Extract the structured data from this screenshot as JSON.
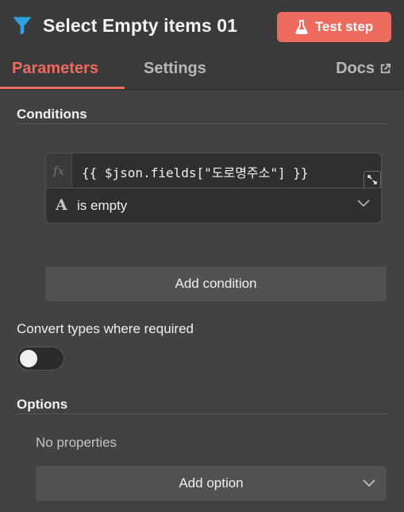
{
  "header": {
    "icon": "filter-icon",
    "title": "Select Empty items 01",
    "test_step_label": "Test step",
    "test_step_icon": "flask-icon",
    "accent_color": "#ec6b5c"
  },
  "tabs": [
    {
      "label": "Parameters",
      "active": true
    },
    {
      "label": "Settings",
      "active": false
    }
  ],
  "docs": {
    "label": "Docs",
    "icon": "external-link-icon"
  },
  "conditions": {
    "title": "Conditions",
    "items": [
      {
        "fx_label": "fx",
        "expression": "{{ $json.fields[\"도로명주소\"] }}",
        "type_icon": "string-type-icon",
        "type_glyph": "A",
        "operator": "is empty"
      }
    ],
    "add_label": "Add condition"
  },
  "convert_types": {
    "label": "Convert types where required",
    "enabled": false
  },
  "options": {
    "title": "Options",
    "empty_text": "No properties",
    "add_label": "Add option"
  }
}
